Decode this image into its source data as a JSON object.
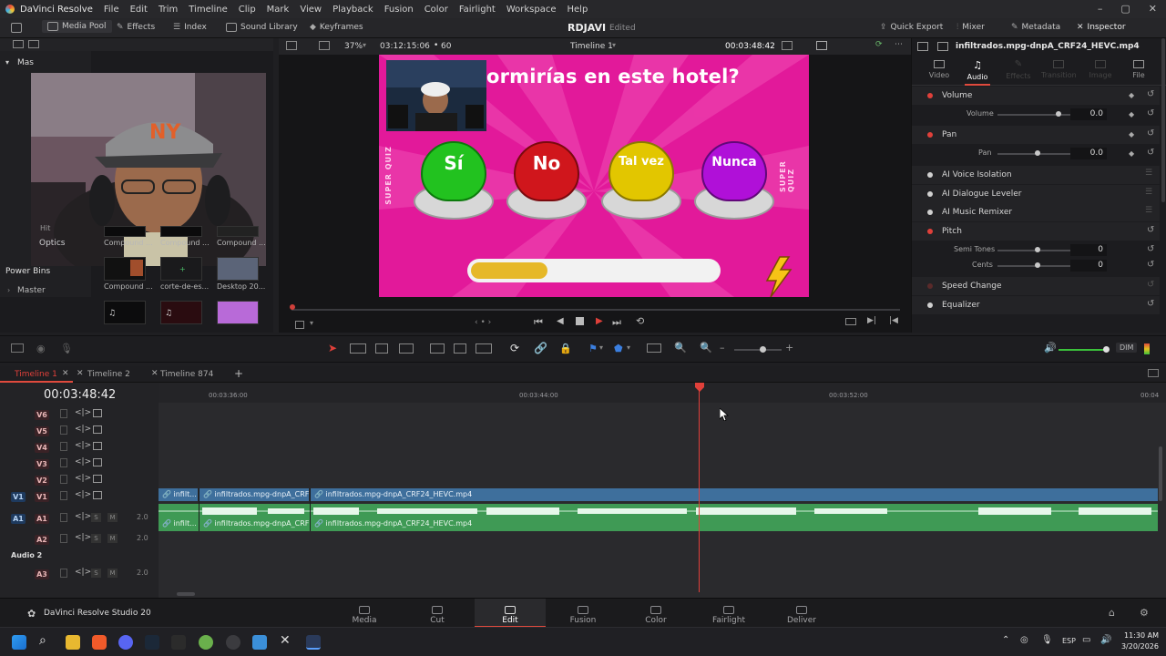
{
  "menubar": {
    "app_name": "DaVinci Resolve",
    "items": [
      "File",
      "Edit",
      "Trim",
      "Timeline",
      "Clip",
      "Mark",
      "View",
      "Playback",
      "Fusion",
      "Color",
      "Fairlight",
      "Workspace",
      "Help"
    ]
  },
  "toolbar": {
    "left": [
      "Media Pool",
      "Effects",
      "Index",
      "Sound Library",
      "Keyframes"
    ],
    "project_title": "RDJAVI",
    "project_status": "Edited",
    "right": [
      "Quick Export",
      "Mixer",
      "Metadata",
      "Inspector"
    ]
  },
  "viewer": {
    "zoom": "37%",
    "source_timecode": "03:12:15:06",
    "fps": "60",
    "timeline_name": "Timeline 1",
    "record_timecode": "00:03:48:42",
    "frame": {
      "question": "ormirías en este hotel?",
      "side_text": "SUPER QUIZ",
      "buttons": [
        "Sí",
        "No",
        "Tal vez",
        "Nunca"
      ],
      "colors": {
        "bg": "#e2199a",
        "si": "#22c21f",
        "no": "#d0161c",
        "talvez": "#e2c600",
        "nunca": "#b010d8"
      }
    }
  },
  "mediapool": {
    "master_label": "Mas",
    "hit_label": "Hit",
    "optics_label": "Optics",
    "power_bins": "Power Bins",
    "master": "Master",
    "clips": [
      "Compound ...",
      "Compound ...",
      "Compound ...",
      "Compound ...",
      "corte-de-es...",
      "Desktop 20..."
    ]
  },
  "inspector": {
    "filename": "infiltrados.mpg-dnpA_CRF24_HEVC.mp4",
    "tabs": [
      "Video",
      "Audio",
      "Effects",
      "Transition",
      "Image",
      "File"
    ],
    "volume": {
      "title": "Volume",
      "label": "Volume",
      "value": "0.0"
    },
    "pan": {
      "title": "Pan",
      "label": "Pan",
      "value": "0.0"
    },
    "ai_items": [
      "AI Voice Isolation",
      "AI Dialogue Leveler",
      "AI Music Remixer"
    ],
    "pitch": {
      "title": "Pitch",
      "semitones_label": "Semi Tones",
      "semitones_value": "0",
      "cents_label": "Cents",
      "cents_value": "0"
    },
    "speed_change": "Speed Change",
    "equalizer": "Equalizer"
  },
  "timeline_toolbar": {
    "dim_label": "DIM"
  },
  "timeline_tabs": [
    "Timeline 1",
    "Timeline 2",
    "Timeline 874"
  ],
  "timeline": {
    "timecode": "00:03:48:42",
    "ruler": [
      "00:03:36:00",
      "00:03:44:00",
      "00:03:52:00",
      "00:04"
    ],
    "video_tracks": [
      "V6",
      "V5",
      "V4",
      "V3",
      "V2",
      "V1"
    ],
    "v1_source": "V1",
    "a1_source": "A1",
    "audio_tracks": [
      {
        "id": "A1",
        "level": "2.0"
      },
      {
        "id": "A2",
        "level": "2.0"
      },
      {
        "id": "A3",
        "level": "2.0"
      }
    ],
    "audio2_label": "Audio 2",
    "clips_video": [
      "infilt...",
      "infiltrados.mpg-dnpA_CRF...",
      "infiltrados.mpg-dnpA_CRF24_HEVC.mp4"
    ],
    "clips_audio": [
      "infilt...",
      "infiltrados.mpg-dnpA_CRF...",
      "infiltrados.mpg-dnpA_CRF24_HEVC.mp4"
    ]
  },
  "pagebar": {
    "app_label": "DaVinci Resolve Studio 20",
    "pages": [
      "Media",
      "Cut",
      "Edit",
      "Fusion",
      "Color",
      "Fairlight",
      "Deliver"
    ],
    "active": "Edit"
  },
  "taskbar": {
    "lang": "ESP",
    "time": "11:30 AM",
    "date": "3/20/2026"
  }
}
